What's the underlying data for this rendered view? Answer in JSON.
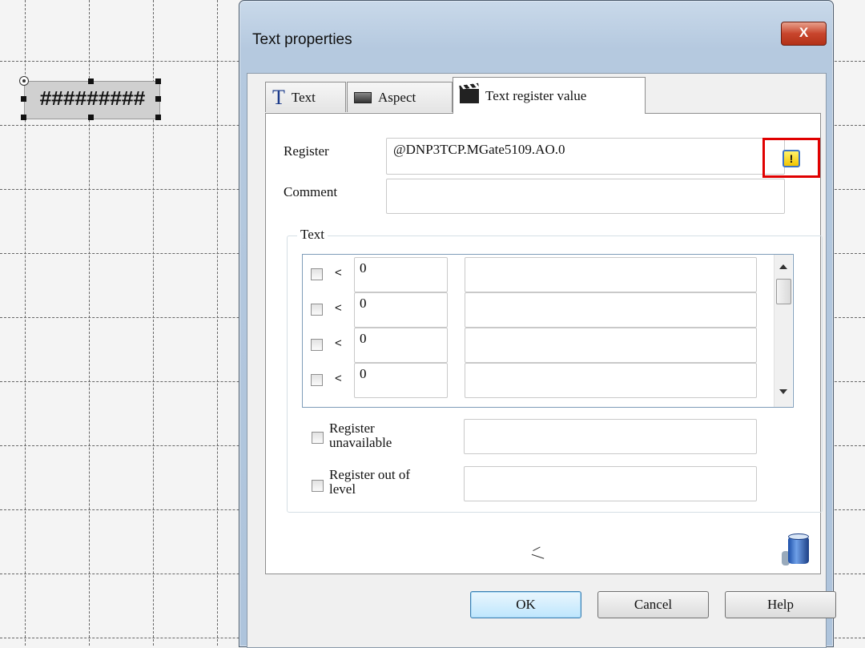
{
  "canvas": {
    "widget_text": "#########"
  },
  "dialog": {
    "title": "Text properties",
    "close_label": "X",
    "tabs": [
      {
        "label": "Text"
      },
      {
        "label": "Aspect"
      },
      {
        "label": "Text register value"
      }
    ],
    "register_label": "Register",
    "register_value": "@DNP3TCP.MGate5109.AO.0",
    "register_select_symbol": "!",
    "comment_label": "Comment",
    "comment_value": "",
    "text_group_label": "Text",
    "rows": [
      {
        "op": "<",
        "value": "0",
        "text": ""
      },
      {
        "op": "<",
        "value": "0",
        "text": ""
      },
      {
        "op": "<",
        "value": "0",
        "text": ""
      },
      {
        "op": "<",
        "value": "0",
        "text": ""
      }
    ],
    "reg_unavailable_line1": "Register",
    "reg_unavailable_line2": "unavailable",
    "reg_out_line1": "Register out of",
    "reg_out_line2": "level",
    "ok_label": "OK",
    "cancel_label": "Cancel",
    "help_label": "Help"
  }
}
